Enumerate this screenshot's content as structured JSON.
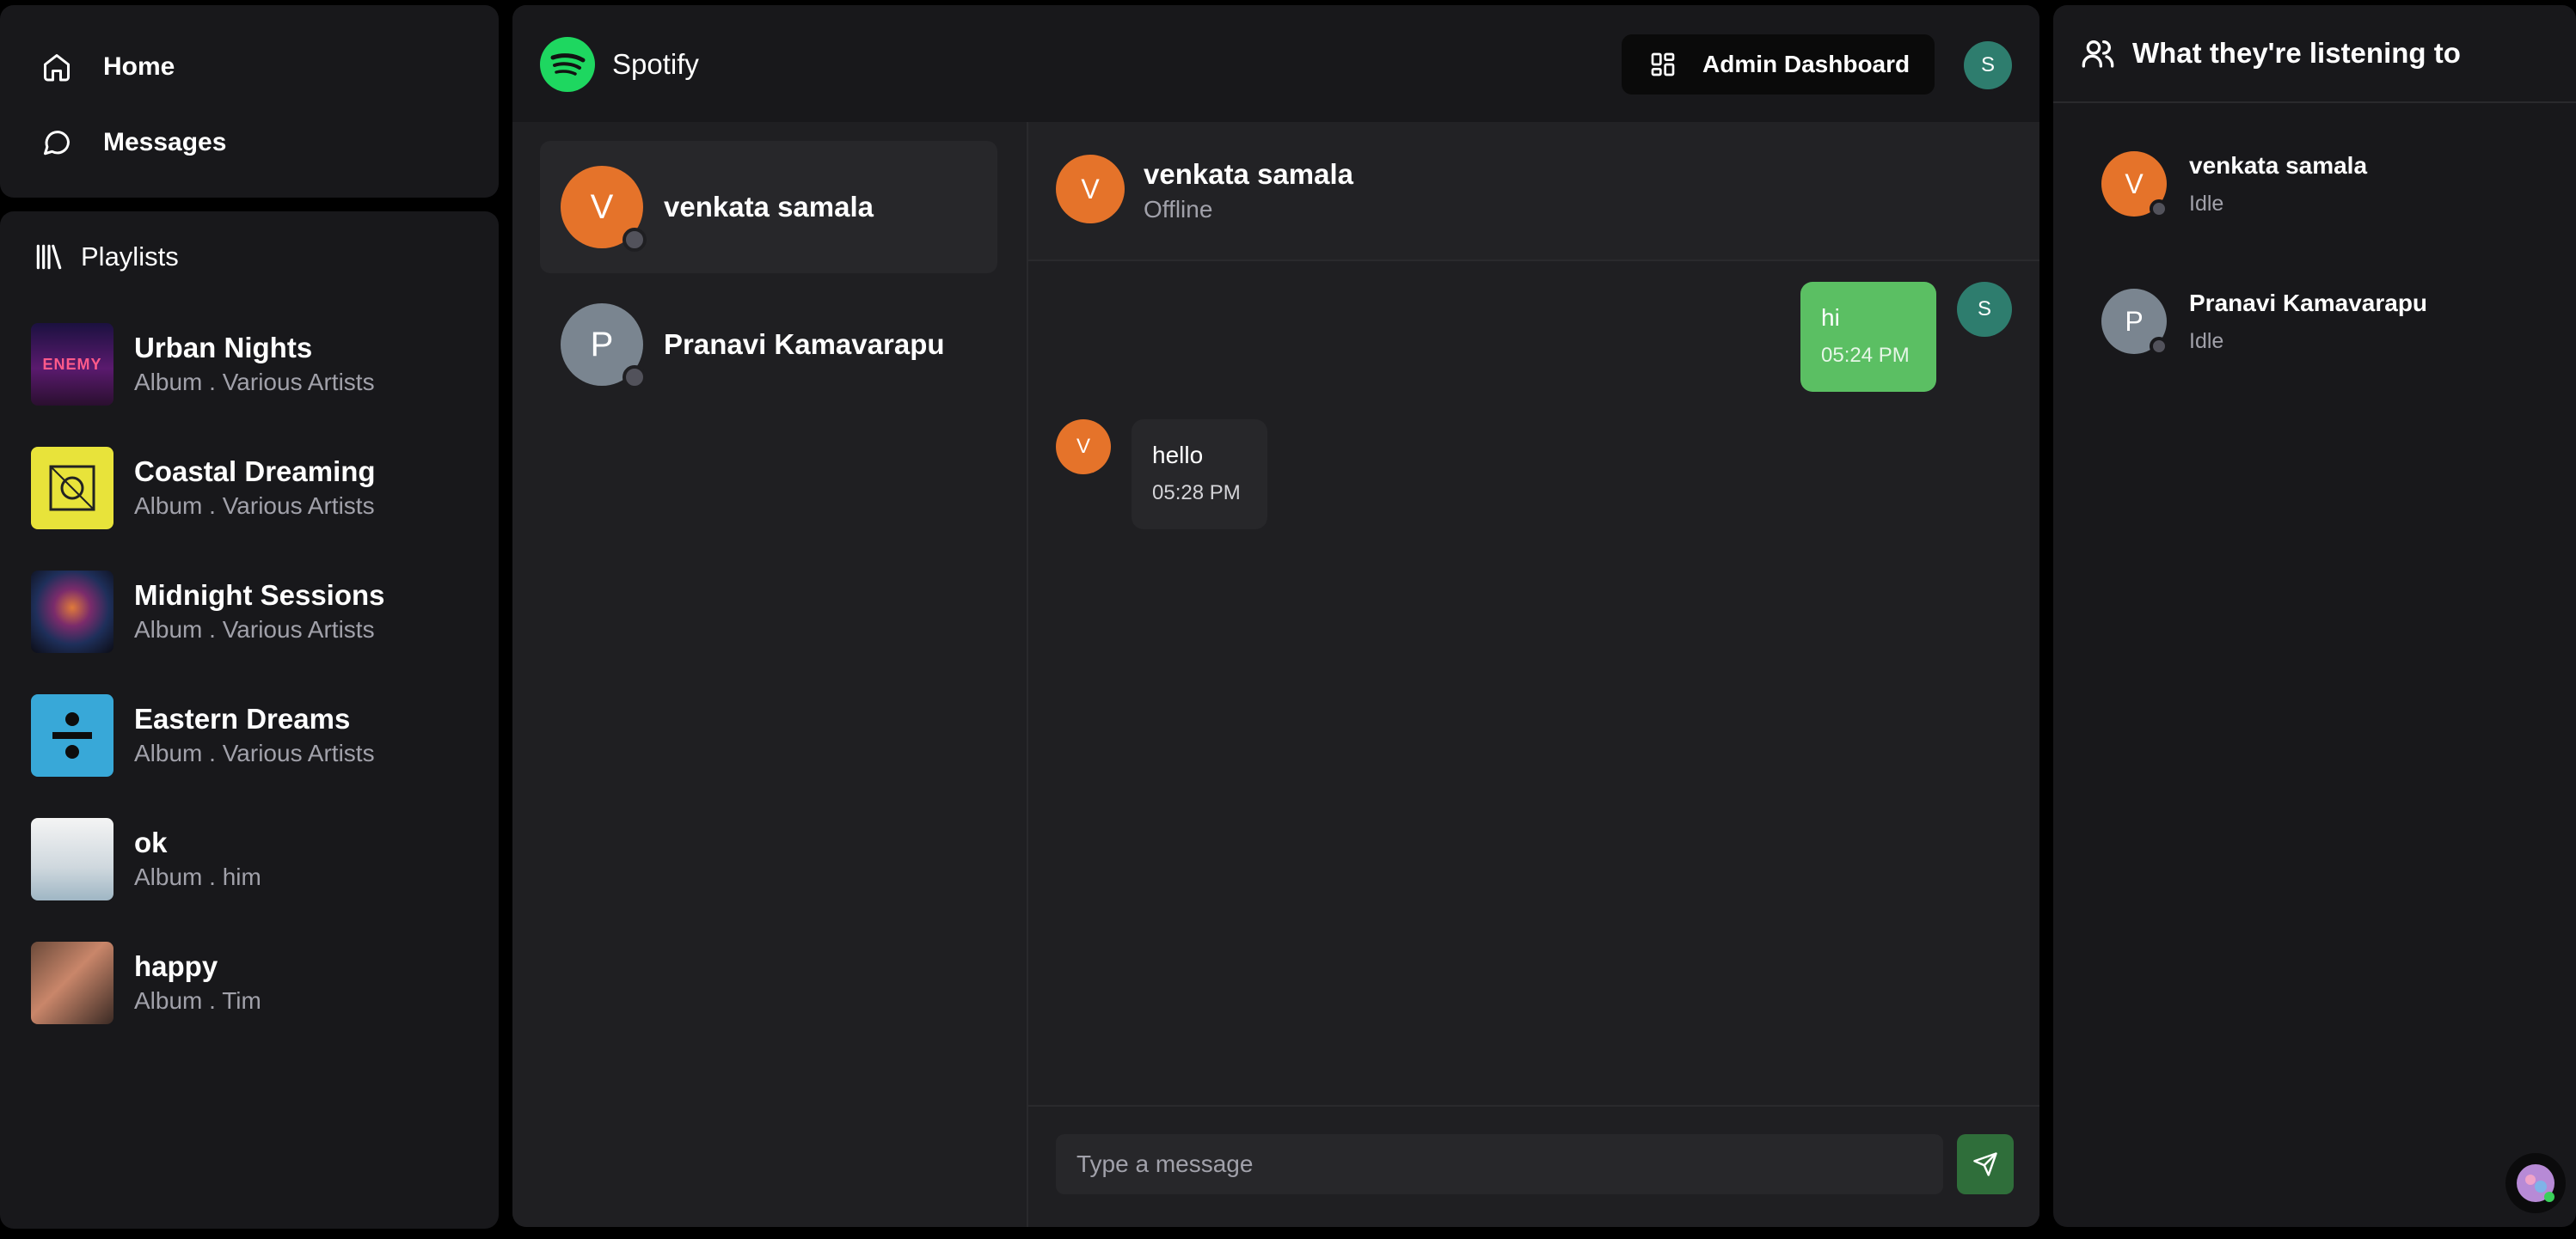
{
  "nav": {
    "home_label": "Home",
    "messages_label": "Messages"
  },
  "playlists": {
    "header": "Playlists",
    "items": [
      {
        "title": "Urban Nights",
        "subtitle": "Album . Various Artists",
        "cover_text": "ENEMY"
      },
      {
        "title": "Coastal Dreaming",
        "subtitle": "Album . Various Artists"
      },
      {
        "title": "Midnight Sessions",
        "subtitle": "Album . Various Artists"
      },
      {
        "title": "Eastern Dreams",
        "subtitle": "Album . Various Artists"
      },
      {
        "title": "ok",
        "subtitle": "Album . him"
      },
      {
        "title": "happy",
        "subtitle": "Album . Tim"
      }
    ]
  },
  "header": {
    "brand": "Spotify",
    "admin_button": "Admin Dashboard",
    "user_initial": "S"
  },
  "conversations": [
    {
      "initial": "V",
      "name": "venkata samala",
      "color": "#e5732a"
    },
    {
      "initial": "P",
      "name": "Pranavi Kamavarapu",
      "color": "#7a8590"
    }
  ],
  "chat": {
    "name": "venkata samala",
    "initial": "V",
    "status": "Offline",
    "messages": [
      {
        "from": "S",
        "text": "hi",
        "time": "05:24 PM"
      },
      {
        "from": "V",
        "text": "hello",
        "time": "05:28 PM"
      }
    ],
    "input_placeholder": "Type a message"
  },
  "activity": {
    "header": "What they're listening to",
    "friends": [
      {
        "initial": "V",
        "name": "venkata samala",
        "status": "Idle",
        "color": "#e5732a"
      },
      {
        "initial": "P",
        "name": "Pranavi Kamavarapu",
        "status": "Idle",
        "color": "#7a8590"
      }
    ]
  },
  "colors": {
    "accent": "#1ed760",
    "bubble_out": "#5bbf63",
    "send": "#2f6e3a"
  }
}
